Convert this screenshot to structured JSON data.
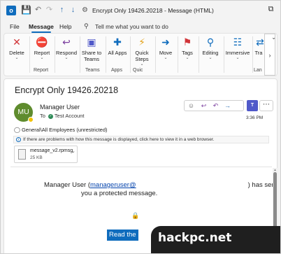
{
  "titlebar": {
    "title": "Encrypt Only 19426.20218  -  Message (HTML)",
    "app_logo_icon": "outlook-logo",
    "quick_access_icons": [
      "save-icon",
      "undo-icon",
      "redo-icon",
      "up-arrow-icon",
      "down-arrow-icon",
      "pin-icon"
    ],
    "restore_icon": "restore-window-icon"
  },
  "menu": {
    "tabs": [
      "File",
      "Message",
      "Help"
    ],
    "active_tab": "Message",
    "tell_me": "Tell me what you want to do"
  },
  "ribbon": {
    "buttons": {
      "delete": "Delete",
      "report": "Report",
      "respond": "Respond",
      "share_to_teams": "Share to Teams",
      "all_apps": "All Apps",
      "quick_steps": "Quick Steps",
      "move": "Move",
      "tags": "Tags",
      "editing": "Editing",
      "immersive": "Immersive",
      "translate": "Tra"
    },
    "groups": {
      "report": "Report",
      "teams": "Teams",
      "apps": "Apps",
      "quick": "Quic",
      "language": "Lan"
    }
  },
  "message": {
    "subject": "Encrypt Only 19426.20218",
    "avatar_initials": "MU",
    "sender": "Manager User",
    "to_label": "To",
    "recipient": "Test Account",
    "time": "3:36 PM",
    "classification": "General\\All Employees (unrestricted)",
    "info_bar": "If there are problems with how this message is displayed, click here to view it in a web browser.",
    "attachment": {
      "name": "message_v2.rpmsg",
      "size": "25 KB"
    },
    "body": {
      "sender_name": "Manager User (",
      "sender_email": "manageruser@",
      "sender_suffix": ") has sent",
      "line2": "you a protected message.",
      "read_link": "Read the"
    }
  },
  "watermark": {
    "text": "hackpc.net"
  },
  "colors": {
    "accent": "#0f6cbd",
    "avatar": "#5f8c2e",
    "teams": "#5059c9"
  }
}
